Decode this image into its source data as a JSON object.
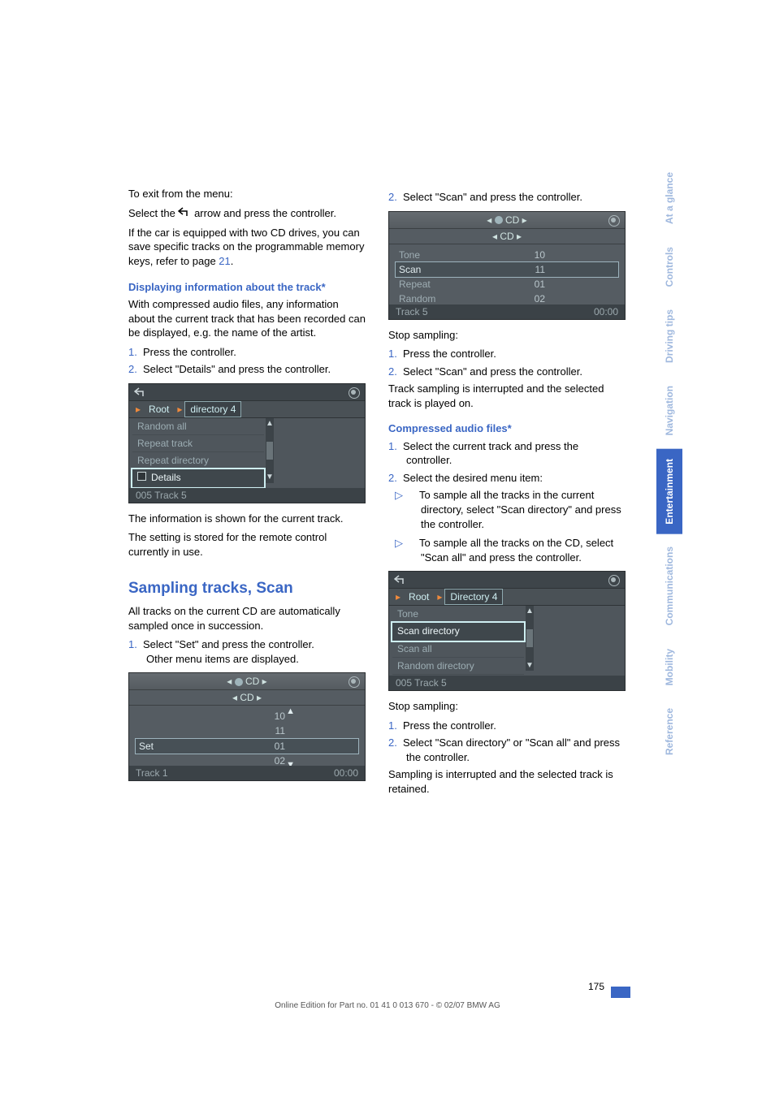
{
  "col1": {
    "exit_menu_1": "To exit from the menu:",
    "exit_menu_2a": "Select the ",
    "exit_menu_2b": " arrow and press the controller.",
    "two_cd_1": "If the car is equipped with two CD drives, you can save specific tracks on the programmable memory keys, refer to page ",
    "two_cd_page": "21",
    "two_cd_2": ".",
    "h_display": "Displaying information about the track*",
    "display_p": "With compressed audio files, any information about the current track that has been recorded can be displayed, e.g. the name of the artist.",
    "display_s1": "Press the controller.",
    "display_s2": "Select \"Details\" and press the controller.",
    "fig2_tab_root": "Root",
    "fig2_tab_dir": "directory 4",
    "fig2_items": [
      "Random all",
      "Repeat track",
      "Repeat directory",
      "Details"
    ],
    "fig2_bottom_l": "005 Track 5",
    "info_shown": "The information is shown for the current track.",
    "remote_setting": "The setting is stored for the remote control currently in use.",
    "h_sampling": "Sampling tracks, Scan",
    "sampling_intro": "All tracks on the current CD are automatically sampled once in succession.",
    "sampling_s1a": "Select \"Set\" and press the controller.",
    "sampling_s1b": "Other menu items are displayed.",
    "fig1_top1": "CD",
    "fig1_top2": "CD",
    "fig1_rows": [
      {
        "l": "",
        "v": "10"
      },
      {
        "l": "",
        "v": "11"
      },
      {
        "l": "Set",
        "v": "01"
      },
      {
        "l": "",
        "v": "02"
      }
    ],
    "fig1_bottom_l": "Track 1",
    "fig1_bottom_r": "00:00"
  },
  "col2": {
    "s2": "Select \"Scan\" and press the controller.",
    "fig1_top1": "CD",
    "fig1_top2": "CD",
    "fig1_rows": [
      {
        "l": "Tone",
        "v": "10"
      },
      {
        "l": "Scan",
        "v": "11"
      },
      {
        "l": "Repeat",
        "v": "01"
      },
      {
        "l": "Random",
        "v": "02"
      }
    ],
    "fig1_bottom_l": "Track 5",
    "fig1_bottom_r": "00:00",
    "stop1": "Stop sampling:",
    "stop1_s1": "Press the controller.",
    "stop1_s2": "Select \"Scan\" and press the controller.",
    "stop1_p": "Track sampling is interrupted and the selected track is played on.",
    "h_compressed": "Compressed audio files*",
    "comp_s1": "Select the current track and press the controller.",
    "comp_s2": "Select the desired menu item:",
    "comp_b1": "To sample all the tracks in the current directory, select \"Scan directory\" and press the controller.",
    "comp_b2": "To sample all the tracks on the CD, select \"Scan all\" and press the controller.",
    "fig2_tab_root": "Root",
    "fig2_tab_dir": "Directory 4",
    "fig2_items": [
      "Tone",
      "Scan directory",
      "Scan all",
      "Random directory"
    ],
    "fig2_bottom_l": "005 Track 5",
    "stop2": "Stop sampling:",
    "stop2_s1": "Press the controller.",
    "stop2_s2": "Select \"Scan directory\" or \"Scan all\" and press the controller.",
    "stop2_p": "Sampling is interrupted and the selected track is retained."
  },
  "page_number": "175",
  "copyright": "Online Edition for Part no. 01 41 0 013 670 - © 02/07 BMW AG",
  "side_tabs": [
    "Reference",
    "Mobility",
    "Communications",
    "Entertainment",
    "Navigation",
    "Driving tips",
    "Controls",
    "At a glance"
  ],
  "side_active_index": 3
}
